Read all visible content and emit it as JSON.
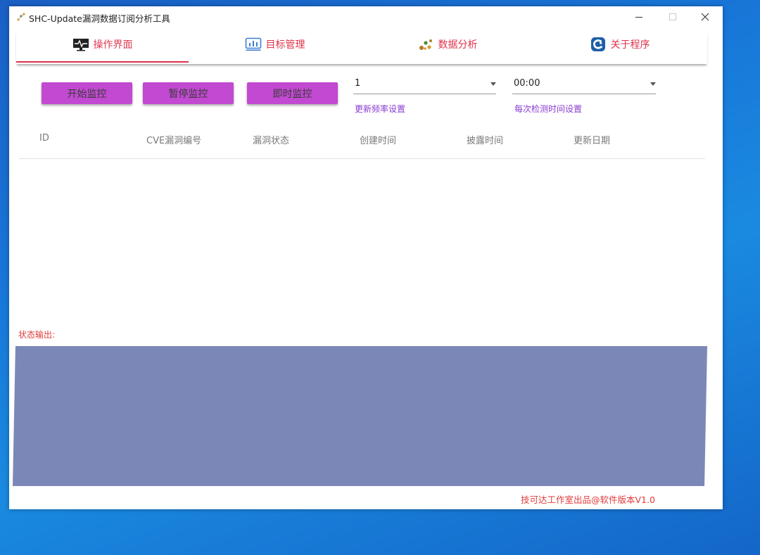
{
  "window": {
    "title": "SHC-Update漏洞数据订阅分析工具",
    "minimize_label": "—",
    "close_label": "✕"
  },
  "tabs": [
    {
      "label": "操作界面",
      "icon": "monitor-pulse-icon",
      "active": true
    },
    {
      "label": "目标管理",
      "icon": "bar-chart-icon",
      "active": false
    },
    {
      "label": "数据分析",
      "icon": "scatter-dots-icon",
      "active": false
    },
    {
      "label": "关于程序",
      "icon": "app-logo-icon",
      "active": false
    }
  ],
  "buttons": {
    "start": "开始监控",
    "pause": "暂停监控",
    "instant": "即时监控"
  },
  "frequency": {
    "value": "1",
    "hint": "更新频率设置"
  },
  "check_time": {
    "value": "00:00",
    "hint": "每次检测时间设置"
  },
  "table": {
    "columns": [
      "ID",
      "CVE漏洞编号",
      "漏洞状态",
      "创建时间",
      "披露时间",
      "更新日期"
    ],
    "rows": []
  },
  "status": {
    "label": "状态输出:",
    "content": ""
  },
  "footer": "技可达工作室出品@软件版本V1.0",
  "colors": {
    "accent": "#e03c52",
    "button": "#c249d1",
    "hint": "#8a3ad2",
    "status_box": "#7b88b7"
  }
}
